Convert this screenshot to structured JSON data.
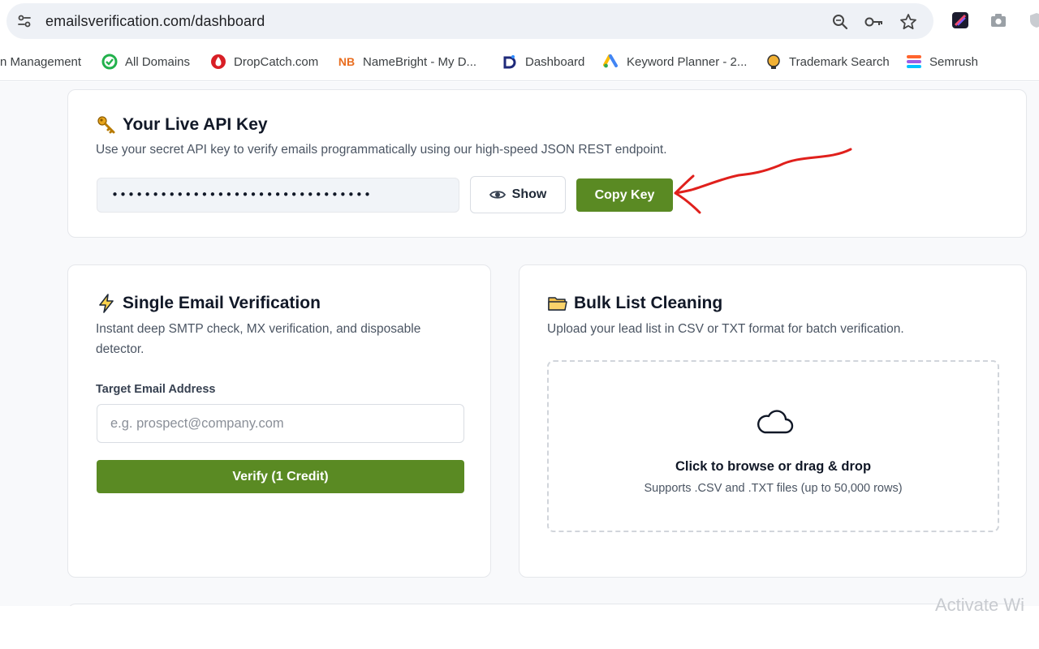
{
  "browser": {
    "url": "emailsverification.com/dashboard",
    "bookmarks": [
      {
        "label": "n Management",
        "icon": "none"
      },
      {
        "label": "All Domains",
        "icon": "all-domains-icon"
      },
      {
        "label": "DropCatch.com",
        "icon": "dropcatch-icon"
      },
      {
        "label": "NameBright - My D...",
        "icon": "namebright-icon",
        "icon_text": "NB"
      },
      {
        "label": "Dashboard",
        "icon": "dashboard-icon"
      },
      {
        "label": "Keyword Planner - 2...",
        "icon": "google-ads-icon"
      },
      {
        "label": "Trademark Search",
        "icon": "trademark-icon"
      },
      {
        "label": "Semrush",
        "icon": "semrush-icon"
      }
    ]
  },
  "api_key": {
    "title": "Your Live API Key",
    "description": "Use your secret API key to verify emails programmatically using our high-speed JSON REST endpoint.",
    "masked_value": "••••••••••••••••••••••••••••••••",
    "show_label": "Show",
    "copy_label": "Copy Key"
  },
  "single": {
    "title": "Single Email Verification",
    "description": "Instant deep SMTP check, MX verification, and disposable detector.",
    "field_label": "Target Email Address",
    "placeholder": "e.g. prospect@company.com",
    "value": "",
    "button_label": "Verify (1 Credit)"
  },
  "bulk": {
    "title": "Bulk List Cleaning",
    "description": "Upload your lead list in CSV or TXT format for batch verification.",
    "drop_title": "Click to browse or drag & drop",
    "drop_subtitle": "Supports .CSV and .TXT files (up to 50,000 rows)"
  },
  "watermark": "Activate Wi",
  "colors": {
    "accent": "#5a8a23",
    "annotation": "#e0201c"
  }
}
